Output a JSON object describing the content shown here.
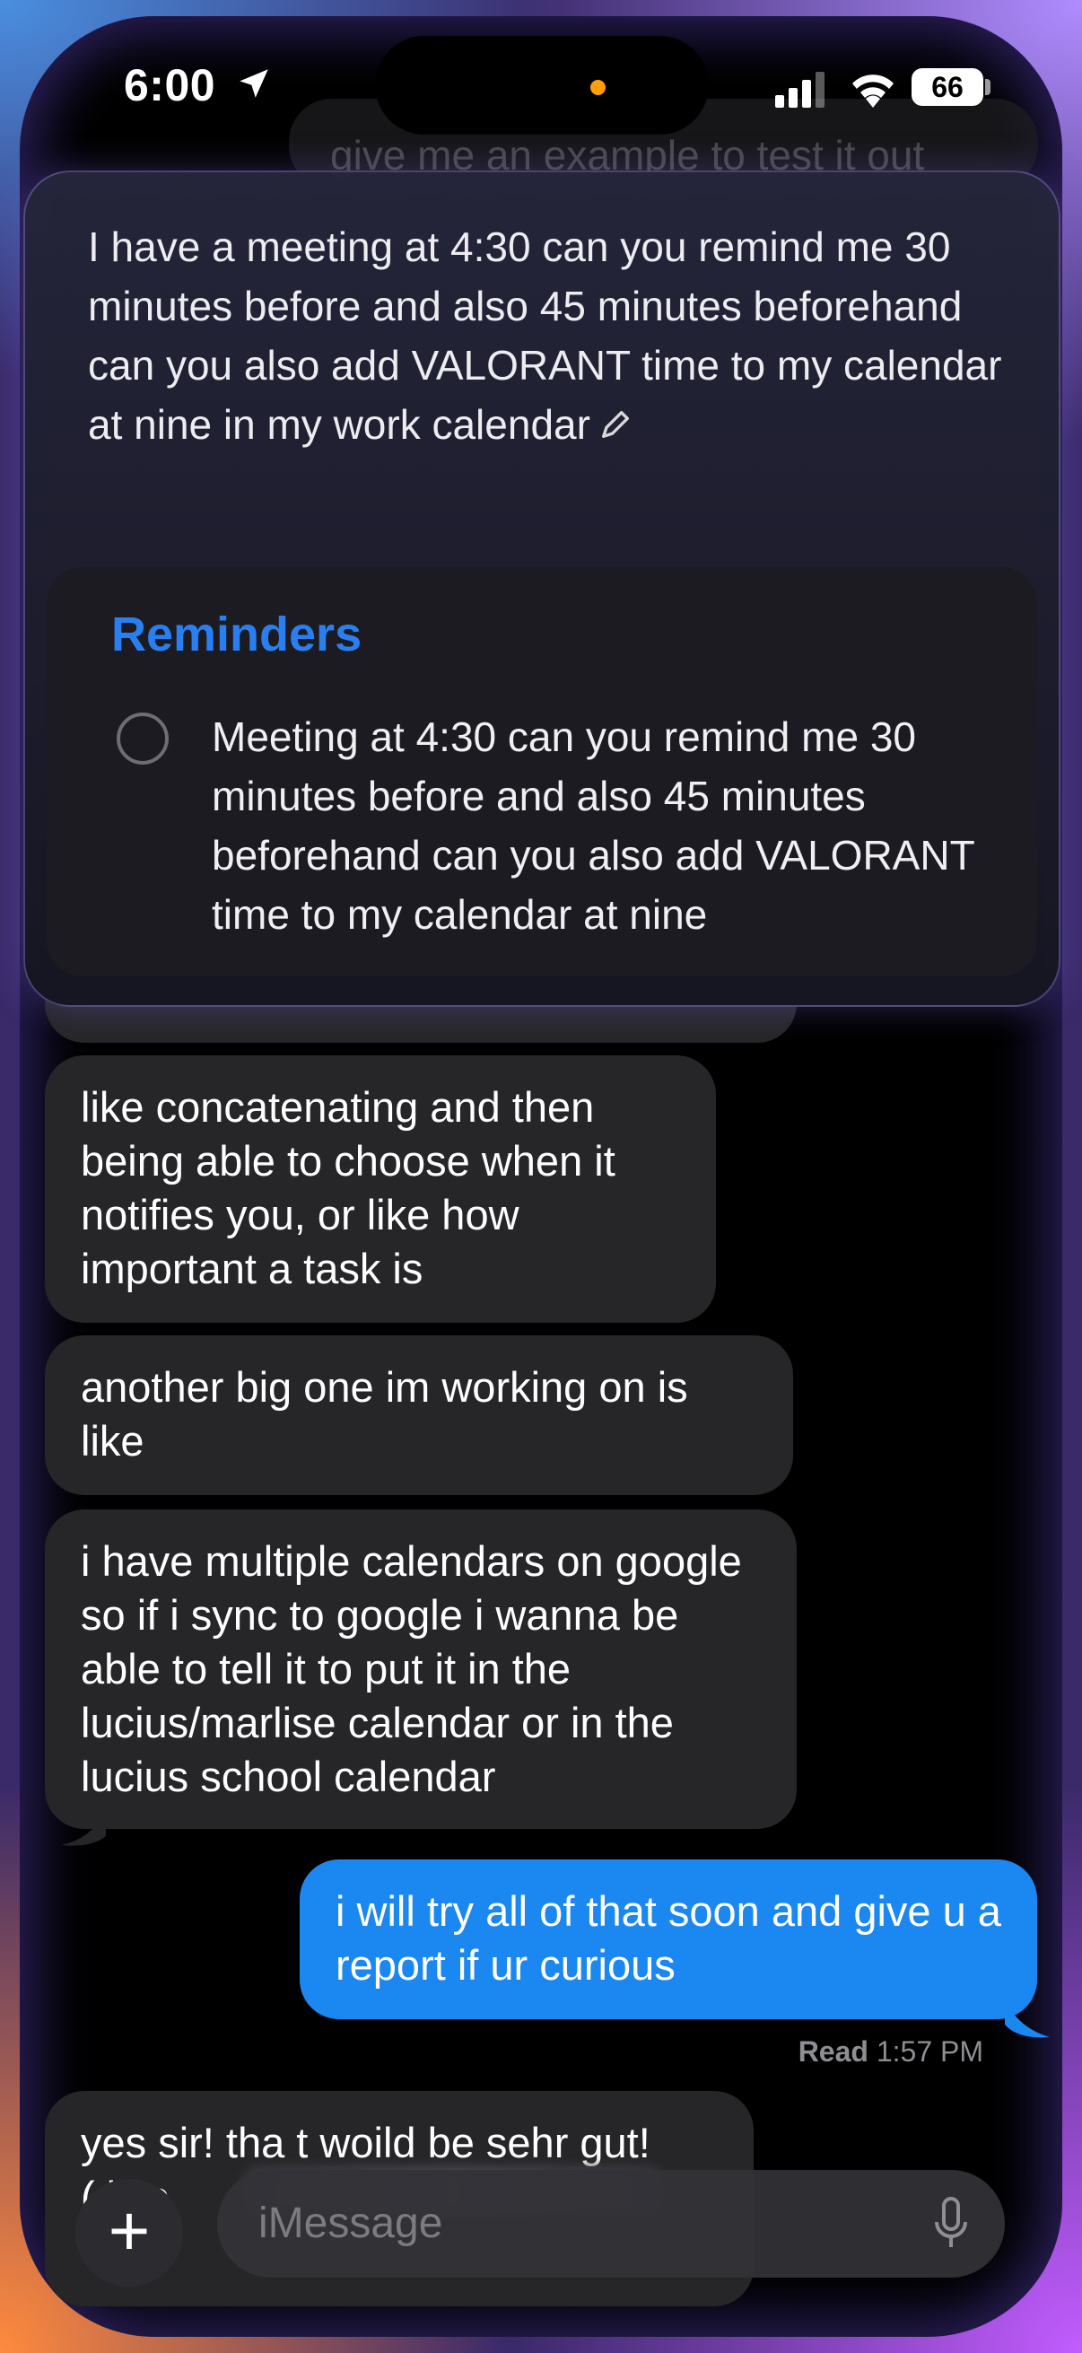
{
  "status_bar": {
    "time": "6:00",
    "battery": "66"
  },
  "background_message": "give me an example to test it out",
  "siri": {
    "query": "I have a meeting at 4:30 can you remind me 30 minutes before and also 45 minutes beforehand can you also add VALORANT time to my calendar at nine in my work calendar",
    "reminders_title": "Reminders",
    "reminder_text": "Meeting at 4:30 can you remind me 30 minutes before and also 45 minutes beforehand can you also add VALORANT time to my calendar at nine"
  },
  "messages": [
    {
      "direction": "incoming",
      "text": "like concatenating and then being able to choose when it notifies you, or like how important a task is"
    },
    {
      "direction": "incoming",
      "text": "another big one im working on is like"
    },
    {
      "direction": "incoming",
      "text": "i have multiple calendars on google so if i sync to google i wanna be able to tell it to put it in the lucius/marlise calendar or in the lucius school calendar"
    },
    {
      "direction": "outgoing",
      "text": "i will try all of that soon and give u a report if ur curious"
    }
  ],
  "receipt": {
    "label": "Read",
    "time": "1:57 PM"
  },
  "last_message": {
    "line1": "yes sir! tha t woild be sehr gut!",
    "line2": "( like"
  },
  "composer": {
    "placeholder": "iMessage",
    "plus": "+"
  },
  "colors": {
    "accent": "#1b87f0",
    "reminders_title": "#2a7ff0",
    "incoming_bubble": "#262629"
  }
}
